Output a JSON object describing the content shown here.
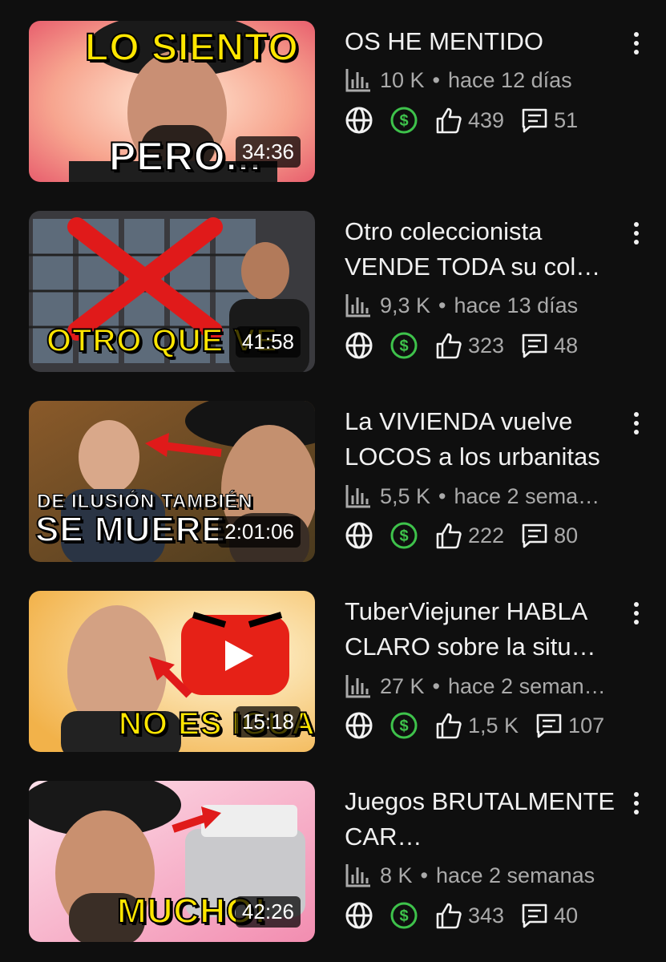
{
  "videos": [
    {
      "title": "OS HE MENTIDO",
      "duration": "34:36",
      "views": "10 K",
      "date": "hace 12 días",
      "likes": "439",
      "comments": "51",
      "thumb_top": "LO SIENTO",
      "thumb_bottom": "PERO..."
    },
    {
      "title": "Otro coleccionista VENDE TODA su col…",
      "duration": "41:58",
      "views": "9,3 K",
      "date": "hace 13 días",
      "likes": "323",
      "comments": "48",
      "thumb_bottom": "OTRO QUE VE"
    },
    {
      "title": "La VIVIENDA vuelve LOCOS a los urbanitas",
      "duration": "2:01:06",
      "views": "5,5 K",
      "date": "hace 2 sema…",
      "likes": "222",
      "comments": "80",
      "thumb_top": "DE ILUSIÓN TAMBIÉN",
      "thumb_bottom": "SE MUERE"
    },
    {
      "title": "TuberViejuner HABLA CLARO sobre la situ…",
      "duration": "15:18",
      "views": "27 K",
      "date": "hace 2 seman…",
      "likes": "1,5 K",
      "comments": "107",
      "thumb_bottom": "NO ES IGUAL"
    },
    {
      "title": "Juegos BRUTALMENTE CAR…",
      "duration": "42:26",
      "views": "8 K",
      "date": "hace 2 semanas",
      "likes": "343",
      "comments": "40",
      "thumb_bottom": "MUCHO!"
    }
  ],
  "colors": {
    "background": "#0f0f0f",
    "monetization": "#3ec24b",
    "text_primary": "#f1f1f1",
    "text_secondary": "#aaaaaa"
  },
  "icons": {
    "analytics": "bar-chart-icon",
    "visibility": "globe-icon",
    "monetization": "dollar-icon",
    "likes": "thumb-up-icon",
    "comments": "comment-icon",
    "menu": "more-vert-icon"
  }
}
